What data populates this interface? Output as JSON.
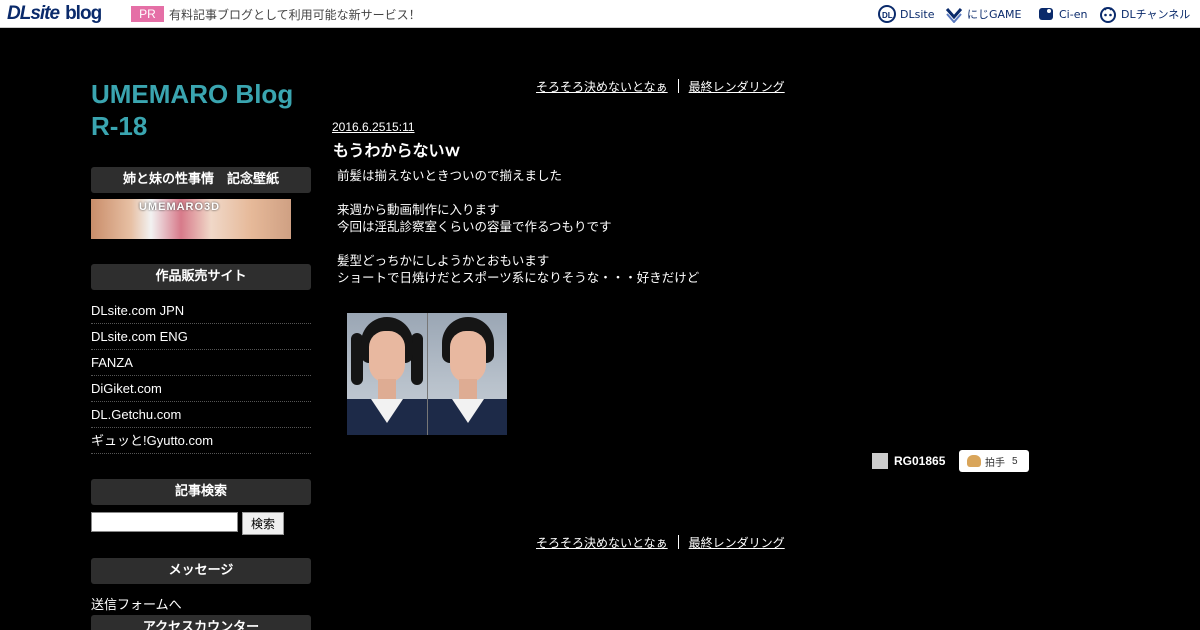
{
  "topbar": {
    "logo_site": "DLsite",
    "logo_blog": "blog",
    "pr_label": "PR",
    "pr_text": "有料記事ブログとして利用可能な新サービス！",
    "services": [
      {
        "label": "DLsite",
        "icon": "dl-icon"
      },
      {
        "label": "にじGAME",
        "icon": "nijigame-icon"
      },
      {
        "label": "Ci-en",
        "icon": "cien-icon"
      },
      {
        "label": "DLチャンネル",
        "icon": "dlchannel-icon"
      }
    ]
  },
  "sidebar": {
    "blog_title_line1": "UMEMARO Blog",
    "blog_title_line2": "R-18",
    "banner_section_title": "姉と妹の性事情　記念壁紙",
    "banner_watermark": "UMEMARO3D",
    "sales_title": "作品販売サイト",
    "sales_sites": [
      "DLsite.com JPN",
      "DLsite.com ENG",
      "FANZA",
      "DiGiket.com",
      "DL.Getchu.com",
      "ギュッと!Gyutto.com"
    ],
    "search_title": "記事検索",
    "search_button": "検索",
    "message_title": "メッセージ",
    "message_link": "送信フォームへ",
    "counter_title": "アクセスカウンター"
  },
  "pager": {
    "prev": "そろそろ決めないとなぁ",
    "next": "最終レンダリング"
  },
  "post": {
    "date": "2016.6.2515:11",
    "title": "もうわからないｗ",
    "lines": [
      "前髪は揃えないときついので揃えました",
      "",
      "来週から動画制作に入ります",
      "今回は淫乱診察室くらいの容量で作るつもりです",
      "",
      "髪型どっちかにしようかとおもいます",
      "ショートで日焼けだとスポーツ系になりそうな・・・好きだけど"
    ],
    "author": "RG01865",
    "clap_label": "拍手",
    "clap_count": "5"
  },
  "colors": {
    "background": "#000000",
    "title_accent": "#3aa5b0",
    "pr_badge": "#e56fa6",
    "side_head_bg": "#2e2e2e"
  }
}
